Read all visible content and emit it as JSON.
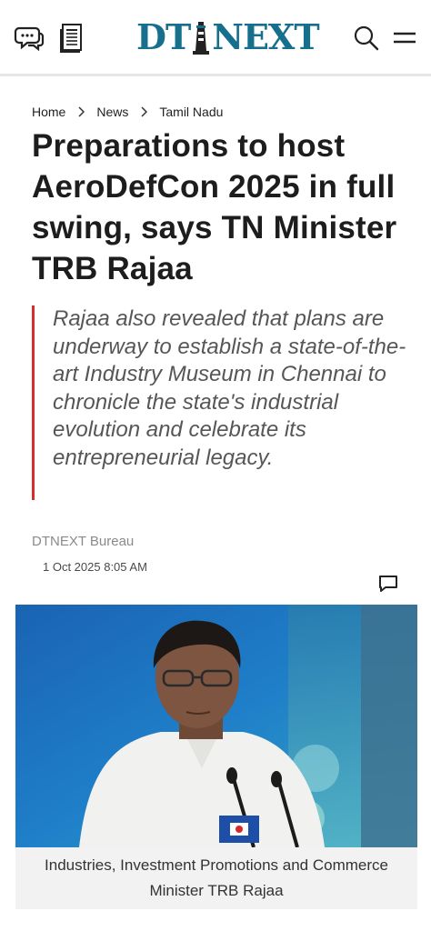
{
  "header": {
    "logo": {
      "left": "DT",
      "right": "NEXT"
    },
    "icons": [
      "chat-bubbles-icon",
      "newspaper-icon",
      "search-icon",
      "menu-icon"
    ]
  },
  "breadcrumb": {
    "items": [
      "Home",
      "News",
      "Tamil Nadu"
    ]
  },
  "article": {
    "title": "Preparations to host AeroDefCon 2025 in full swing, says TN Minister TRB Rajaa",
    "summary": "Rajaa also revealed that plans are underway to establish a state-of-the-art Industry Museum in Chennai to chronicle the state's industrial evolution and celebrate its entrepreneurial legacy.",
    "author": "DTNEXT Bureau",
    "date": "1 Oct 2025 8:05 AM",
    "image_caption": "Industries, Investment Promotions and Commerce Minister TRB Rajaa"
  },
  "colors": {
    "brand": "#166f8c",
    "accent_bar": "#d32f2f"
  }
}
